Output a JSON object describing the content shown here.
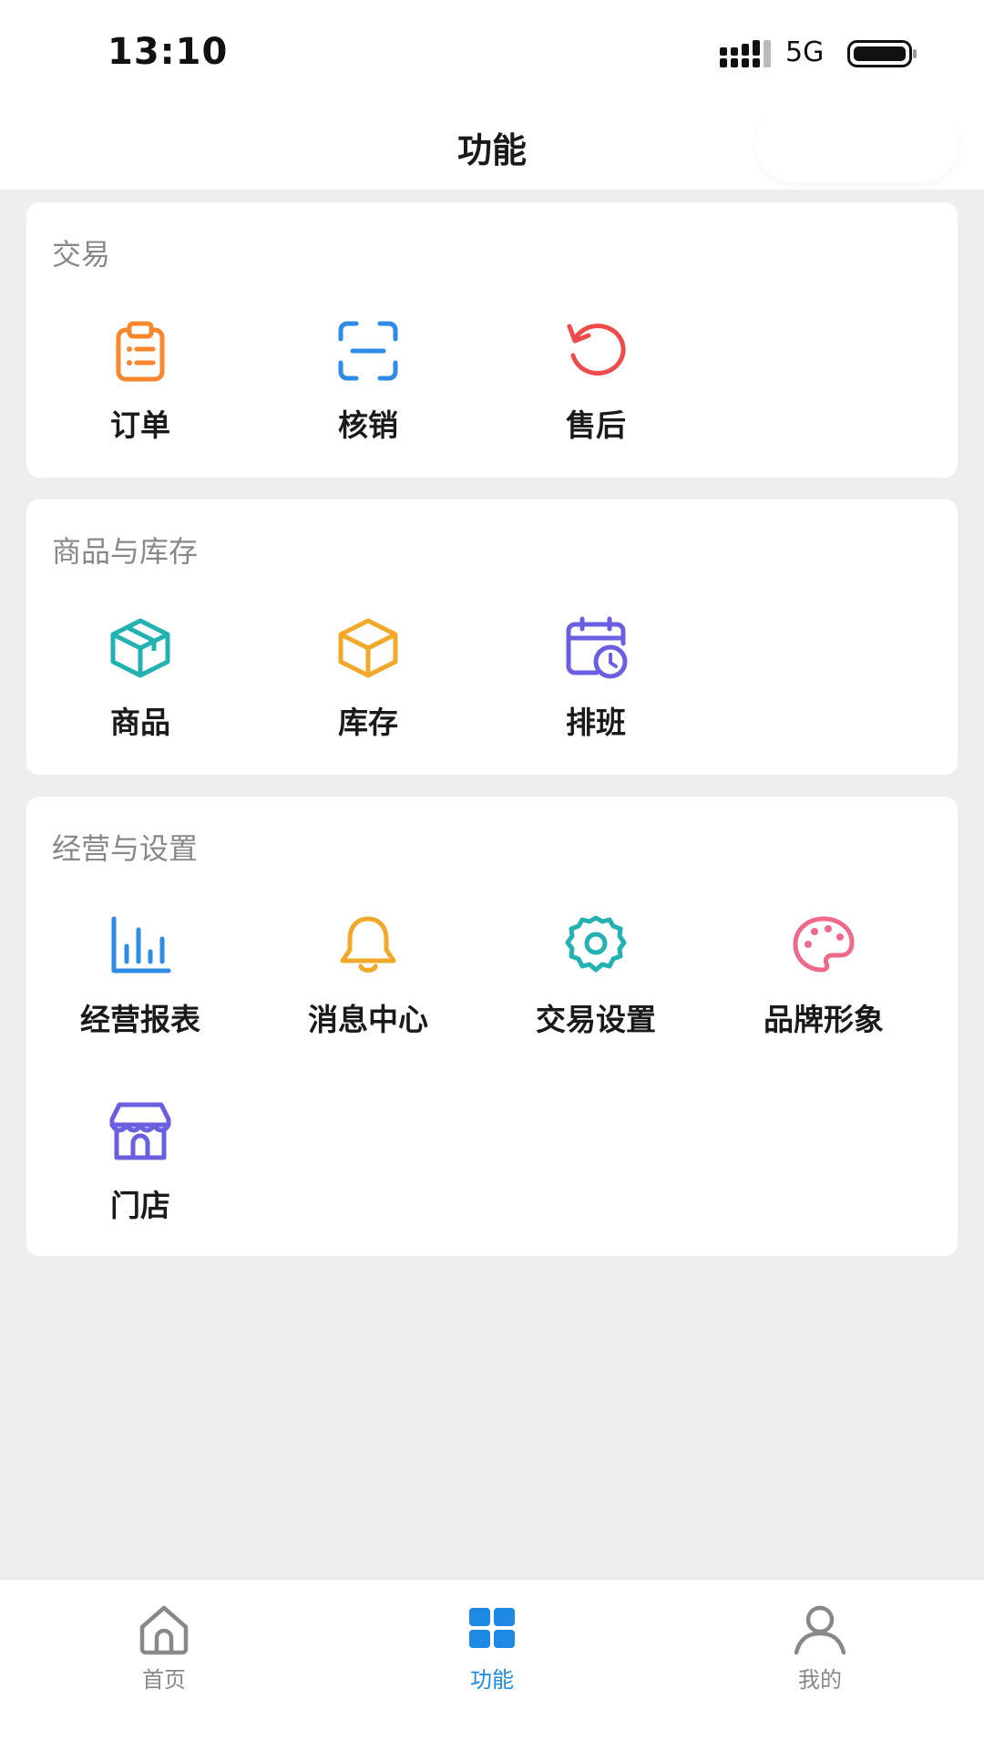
{
  "status": {
    "time": "13:10",
    "network": "5G"
  },
  "header": {
    "title": "功能"
  },
  "sections": [
    {
      "title": "交易",
      "items": [
        {
          "label": "订单",
          "icon": "clipboard-icon",
          "color": "#F7862D"
        },
        {
          "label": "核销",
          "icon": "scan-icon",
          "color": "#2E8BE6"
        },
        {
          "label": "售后",
          "icon": "undo-icon",
          "color": "#EF4B4B"
        }
      ]
    },
    {
      "title": "商品与库存",
      "items": [
        {
          "label": "商品",
          "icon": "box-icon",
          "color": "#23B2B2"
        },
        {
          "label": "库存",
          "icon": "cube-icon",
          "color": "#F2A92A"
        },
        {
          "label": "排班",
          "icon": "calendar-clock-icon",
          "color": "#6A5FE0"
        }
      ]
    },
    {
      "title": "经营与设置",
      "items": [
        {
          "label": "经营报表",
          "icon": "bar-chart-icon",
          "color": "#2E8BE6"
        },
        {
          "label": "消息中心",
          "icon": "bell-icon",
          "color": "#F2A92A"
        },
        {
          "label": "交易设置",
          "icon": "gear-icon",
          "color": "#23B2B2"
        },
        {
          "label": "品牌形象",
          "icon": "palette-icon",
          "color": "#EF6A8A"
        },
        {
          "label": "门店",
          "icon": "store-icon",
          "color": "#6A5FE0"
        }
      ]
    }
  ],
  "tabs": [
    {
      "label": "首页",
      "icon": "home-icon",
      "active": false
    },
    {
      "label": "功能",
      "icon": "grid-icon",
      "active": true,
      "color": "#1E88E5"
    },
    {
      "label": "我的",
      "icon": "user-icon",
      "active": false
    }
  ]
}
